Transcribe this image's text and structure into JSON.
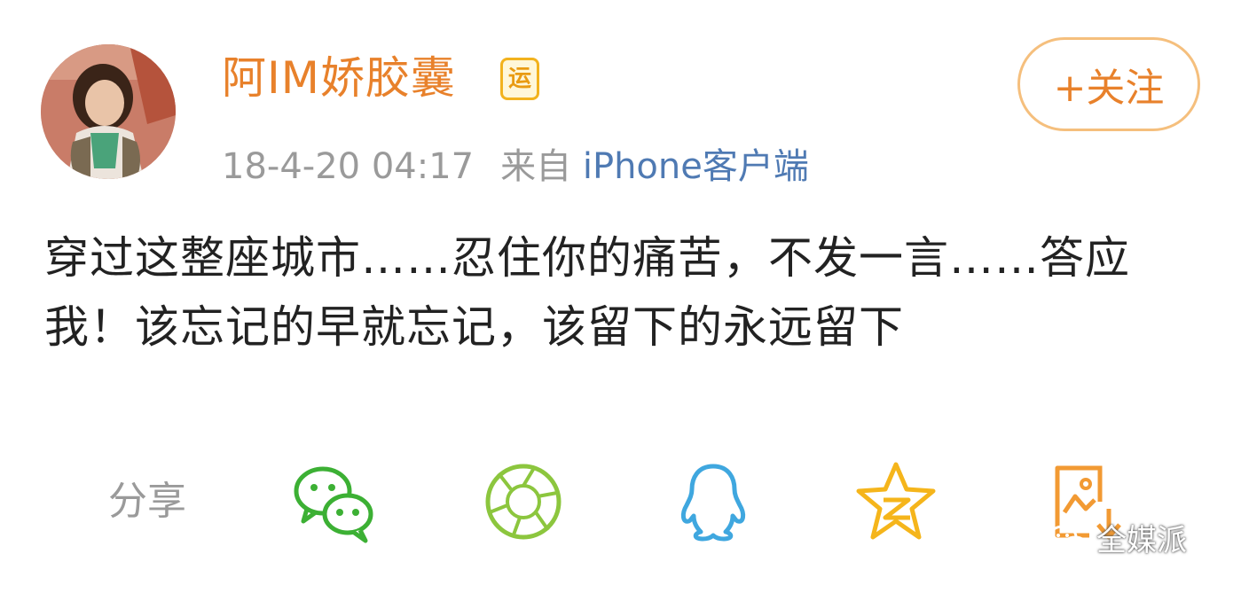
{
  "post": {
    "username": "阿IM娇胶囊",
    "badge_text": "运",
    "follow_label": "+关注",
    "timestamp": "18-4-20 04:17",
    "source_prefix": "来自",
    "source": "iPhone客户端",
    "content": "穿过这整座城市……忍住你的痛苦，不发一言……答应我！该忘记的早就忘记，该留下的永远留下"
  },
  "share": {
    "label": "分享",
    "targets": [
      "wechat-icon",
      "moments-icon",
      "qq-icon",
      "qzone-icon",
      "save-image-icon"
    ]
  },
  "watermark": {
    "text": "全媒派"
  },
  "colors": {
    "username": "#e8812b",
    "link": "#4f7ab3",
    "meta": "#9a9a9a",
    "wechat": "#3cb034",
    "moments": "#8cc63e",
    "qq": "#3fa7df",
    "qzone": "#f5b51b",
    "save": "#f29a33"
  }
}
